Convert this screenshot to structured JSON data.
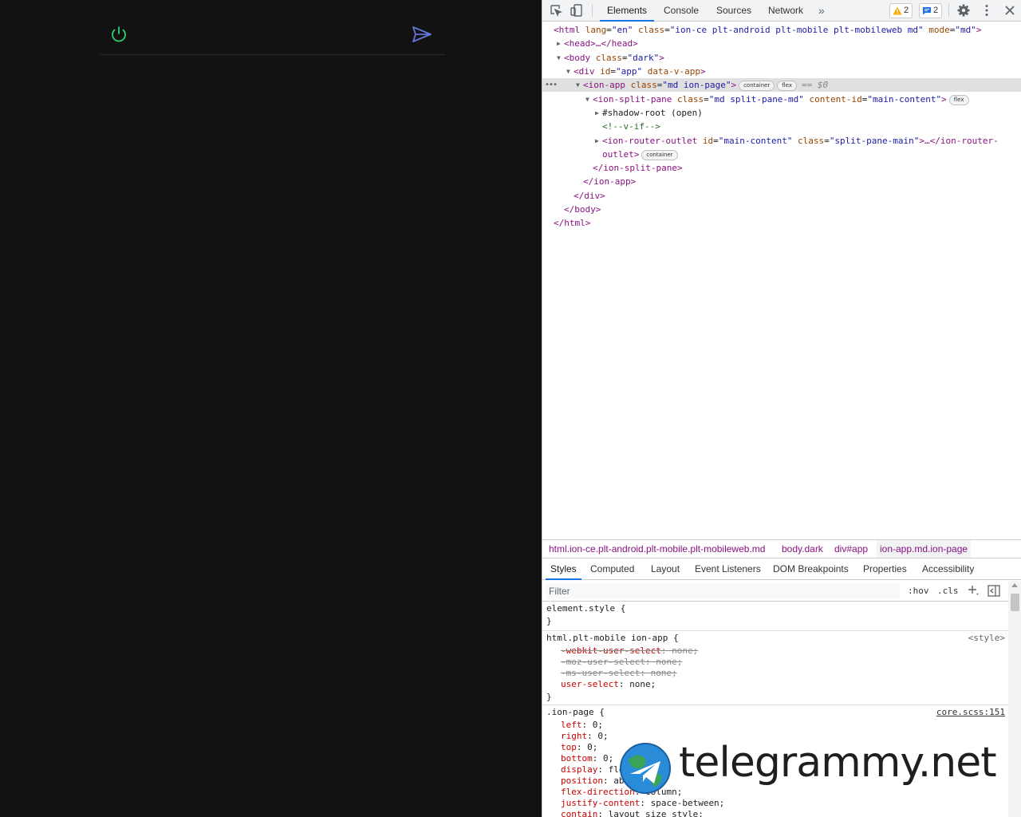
{
  "app": {
    "accent_power": "#2dd36f",
    "accent_send": "#6675d6"
  },
  "devtools": {
    "tabs": [
      "Elements",
      "Console",
      "Sources",
      "Network"
    ],
    "more_tabs": "»",
    "warnings_count": "2",
    "messages_count": "2",
    "dom": {
      "html_open": {
        "tag": "<html",
        "a1": " lang",
        "v1": "\"en\"",
        "a2": " class",
        "v2": "\"ion-ce plt-android plt-mobile plt-mobileweb md\"",
        "a3": " mode",
        "v3": "\"md\"",
        "end": ">"
      },
      "head": {
        "text": "<head>…</head>"
      },
      "body_open": {
        "tag": "<body",
        "a1": " class",
        "v1": "\"dark\"",
        "end": ">"
      },
      "div_open": {
        "tag": "<div",
        "a1": " id",
        "v1": "\"app\"",
        "a2": " data-v-app",
        "end": ">"
      },
      "ion_app": {
        "tag": "<ion-app",
        "a1": " class",
        "v1": "\"md ion-page\"",
        "end": ">",
        "pill1": "container",
        "pill2": "flex",
        "dollar": "== $0"
      },
      "split_pane": {
        "tag": "<ion-split-pane",
        "a1": " class",
        "v1": "\"md split-pane-md\"",
        "a2": " content-id",
        "v2": "\"main-content\"",
        "end": ">",
        "pill": "flex"
      },
      "shadow_root": "#shadow-root (open)",
      "comment": "<!--v-if-->",
      "router_outlet_1": {
        "tag": "<ion-router-outlet",
        "a1": " id",
        "v1": "\"main-content\"",
        "a2": " class",
        "v2": "\"split-pane-main\"",
        "end": ">…</ion-router-"
      },
      "router_outlet_2": {
        "text": "outlet>",
        "pill": "container"
      },
      "split_pane_close": "</ion-split-pane>",
      "ion_app_close": "</ion-app>",
      "div_close": "</div>",
      "body_close": "</body>",
      "html_close": "</html>"
    },
    "breadcrumbs": [
      "html.ion-ce.plt-android.plt-mobile.plt-mobileweb.md",
      "body.dark",
      "div#app",
      "ion-app.md.ion-page"
    ],
    "sub_tabs": [
      "Styles",
      "Computed",
      "Layout",
      "Event Listeners",
      "DOM Breakpoints",
      "Properties",
      "Accessibility"
    ],
    "filter_placeholder": "Filter",
    "hov": ":hov",
    "cls": ".cls",
    "styles": {
      "element_style": {
        "selector": "element.style {",
        "close": "}"
      },
      "rule1": {
        "selector": "html.plt-mobile ion-app {",
        "source": "<style>",
        "lines": [
          {
            "prop": "-webkit-user-select",
            "value": " none;",
            "struck": true
          },
          {
            "prop": "-moz-user-select",
            "value": " none;",
            "struck": true
          },
          {
            "prop": "-ms-user-select",
            "value": " none;",
            "struck": true
          },
          {
            "prop": "user-select",
            "value": " none;",
            "struck": false
          }
        ],
        "close": "}"
      },
      "rule2": {
        "selector": ".ion-page {",
        "source": "core.scss:151",
        "lines": [
          {
            "prop": "left",
            "value": " 0;"
          },
          {
            "prop": "right",
            "value": " 0;"
          },
          {
            "prop": "top",
            "value": " 0;"
          },
          {
            "prop": "bottom",
            "value": " 0;"
          },
          {
            "prop": "display",
            "value": " flex;"
          },
          {
            "prop": "position",
            "value": " absolute;"
          },
          {
            "prop": "flex-direction",
            "value": " column;"
          },
          {
            "prop": "justify-content",
            "value": " space-between;"
          },
          {
            "prop": "contain",
            "value": " layout size style;"
          }
        ]
      }
    }
  },
  "watermark": {
    "text": "telegrammy.net"
  }
}
